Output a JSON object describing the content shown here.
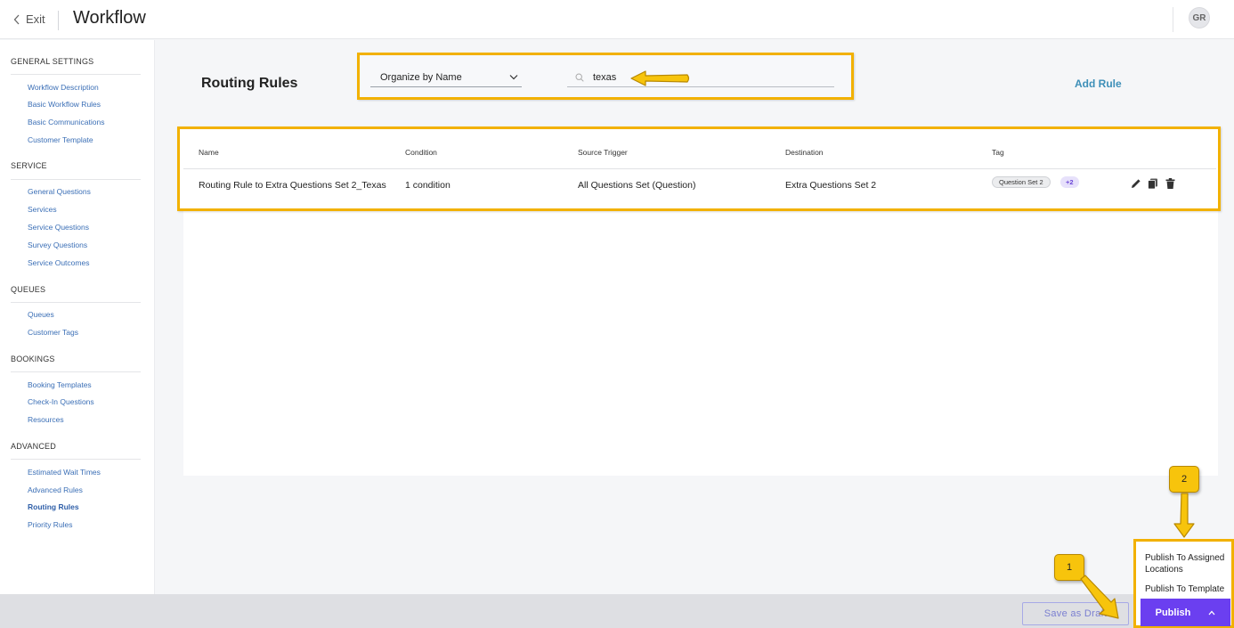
{
  "header": {
    "exit_label": "Exit",
    "title": "Workflow",
    "avatar_initials": "GR"
  },
  "sidebar": {
    "sections": [
      {
        "title": "GENERAL SETTINGS",
        "items": [
          "Workflow Description",
          "Basic Workflow Rules",
          "Basic Communications",
          "Customer Template"
        ]
      },
      {
        "title": "SERVICE",
        "items": [
          "General Questions",
          "Services",
          "Service Questions",
          "Survey Questions",
          "Service Outcomes"
        ]
      },
      {
        "title": "QUEUES",
        "items": [
          "Queues",
          "Customer Tags"
        ]
      },
      {
        "title": "BOOKINGS",
        "items": [
          "Booking Templates",
          "Check-In Questions",
          "Resources"
        ]
      },
      {
        "title": "ADVANCED",
        "items": [
          "Estimated Wait Times",
          "Advanced Rules",
          "Routing Rules",
          "Priority Rules"
        ]
      }
    ],
    "active_item": "Routing Rules"
  },
  "main": {
    "heading": "Routing Rules",
    "organize_select": "Organize by Name",
    "search_value": "texas",
    "add_rule_label": "Add Rule",
    "table": {
      "columns": [
        "Name",
        "Condition",
        "Source Trigger",
        "Destination",
        "Tag"
      ],
      "rows": [
        {
          "name": "Routing Rule to Extra Questions Set 2_Texas",
          "condition": "1 condition",
          "source_trigger": "All Questions Set (Question)",
          "destination": "Extra Questions Set 2",
          "tag": "Question Set 2",
          "tag_more": "+2"
        }
      ]
    }
  },
  "footer": {
    "save_draft_label": "Save as Draft",
    "publish_label": "Publish",
    "publish_menu": [
      "Publish To Assigned Locations",
      "Publish To Template"
    ]
  },
  "annotations": {
    "badge_1": "1",
    "badge_2": "2",
    "highlight_color": "#f2b100"
  },
  "colors": {
    "publish_bg": "#6b3ff0",
    "link": "#3b6fb6",
    "add_rule": "#3d8fb8"
  }
}
